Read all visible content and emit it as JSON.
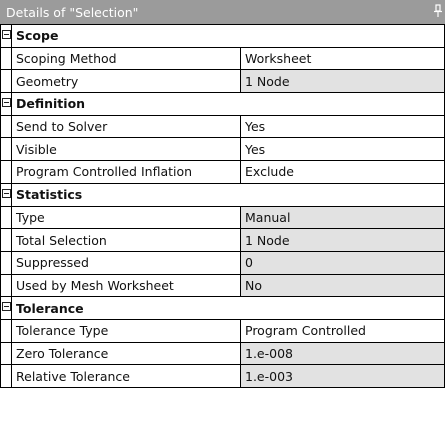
{
  "window": {
    "title": "Details of \"Selection\""
  },
  "groups": [
    {
      "label": "Scope",
      "rows": [
        {
          "name": "Scoping Method",
          "value": "Worksheet",
          "readonly": false
        },
        {
          "name": "Geometry",
          "value": "1 Node",
          "readonly": true
        }
      ]
    },
    {
      "label": "Definition",
      "rows": [
        {
          "name": "Send to Solver",
          "value": "Yes",
          "readonly": false
        },
        {
          "name": "Visible",
          "value": "Yes",
          "readonly": false
        },
        {
          "name": "Program Controlled Inflation",
          "value": "Exclude",
          "readonly": false
        }
      ]
    },
    {
      "label": "Statistics",
      "rows": [
        {
          "name": "Type",
          "value": "Manual",
          "readonly": true
        },
        {
          "name": "Total Selection",
          "value": "1 Node",
          "readonly": true
        },
        {
          "name": "Suppressed",
          "value": "0",
          "readonly": true
        },
        {
          "name": "Used by Mesh Worksheet",
          "value": "No",
          "readonly": true
        }
      ]
    },
    {
      "label": "Tolerance",
      "rows": [
        {
          "name": "Tolerance Type",
          "value": "Program Controlled",
          "readonly": false
        },
        {
          "name": "Zero Tolerance",
          "value": "1.e-008",
          "readonly": true
        },
        {
          "name": "Relative Tolerance",
          "value": "1.e-003",
          "readonly": true
        }
      ]
    }
  ],
  "icons": {
    "collapse": "collapse-minus-icon",
    "pin": "pin-icon"
  },
  "colors": {
    "titlebar": "#9b9b9b",
    "readonly_cell": "#e2e2e2",
    "gridline": "#000000"
  }
}
